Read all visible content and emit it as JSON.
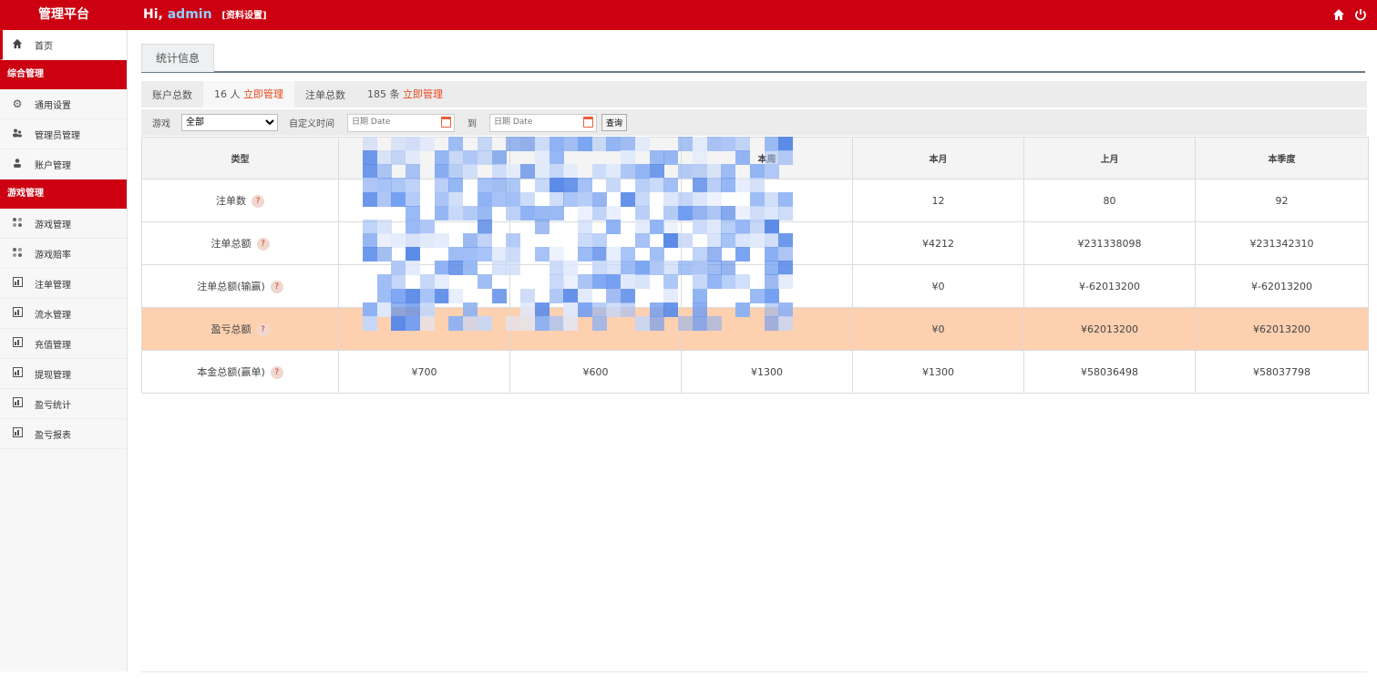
{
  "header": {
    "brand": "管理平台",
    "greeting": "Hi,",
    "username": "admin",
    "profile_link": "[资料设置]"
  },
  "sidebar": {
    "home": "首页",
    "groups": [
      {
        "title": "综合管理",
        "items": [
          "通用设置",
          "管理员管理",
          "账户管理"
        ]
      },
      {
        "title": "游戏管理",
        "items": [
          "游戏管理",
          "游戏赔率",
          "注单管理",
          "流水管理",
          "充值管理",
          "提现管理",
          "盈亏统计",
          "盈亏报表"
        ]
      }
    ]
  },
  "tab": {
    "label": "统计信息"
  },
  "summary": {
    "accounts_label": "账户总数",
    "accounts_value": "16 人",
    "accounts_link": "立即管理",
    "bets_label": "注单总数",
    "bets_value": "185 条",
    "bets_link": "立即管理"
  },
  "filter": {
    "game_label": "游戏",
    "game_selected": "全部",
    "time_label": "自定义时间",
    "date_placeholder": "日期 Date",
    "to_label": "到",
    "query_button": "查询"
  },
  "table": {
    "headers": [
      "类型",
      "",
      "",
      "本周",
      "本月",
      "上月",
      "本季度"
    ],
    "rows": [
      {
        "label": "注单数",
        "help": "?",
        "cells": [
          "",
          "",
          "",
          "12",
          "80",
          "92"
        ]
      },
      {
        "label": "注单总额",
        "help": "?",
        "cells": [
          "",
          "",
          "",
          "¥4212",
          "¥231338098",
          "¥231342310"
        ]
      },
      {
        "label": "注单总额(输赢)",
        "help": "?",
        "cells": [
          "",
          "",
          "",
          "¥0",
          "¥-62013200",
          "¥-62013200"
        ]
      },
      {
        "label": "盈亏总额",
        "help": "?",
        "cells": [
          "",
          "",
          "",
          "¥0",
          "¥62013200",
          "¥62013200"
        ]
      },
      {
        "label": "本金总额(赢单)",
        "help": "?",
        "cells": [
          "¥700",
          "¥600",
          "¥1300",
          "¥1300",
          "¥58036498",
          "¥58037798"
        ]
      }
    ]
  },
  "colors": {
    "primary": "#cc0010",
    "link": "#e54a1f",
    "highlight_row": "#fdd0b0",
    "mosaic": "#7fa7f0"
  }
}
